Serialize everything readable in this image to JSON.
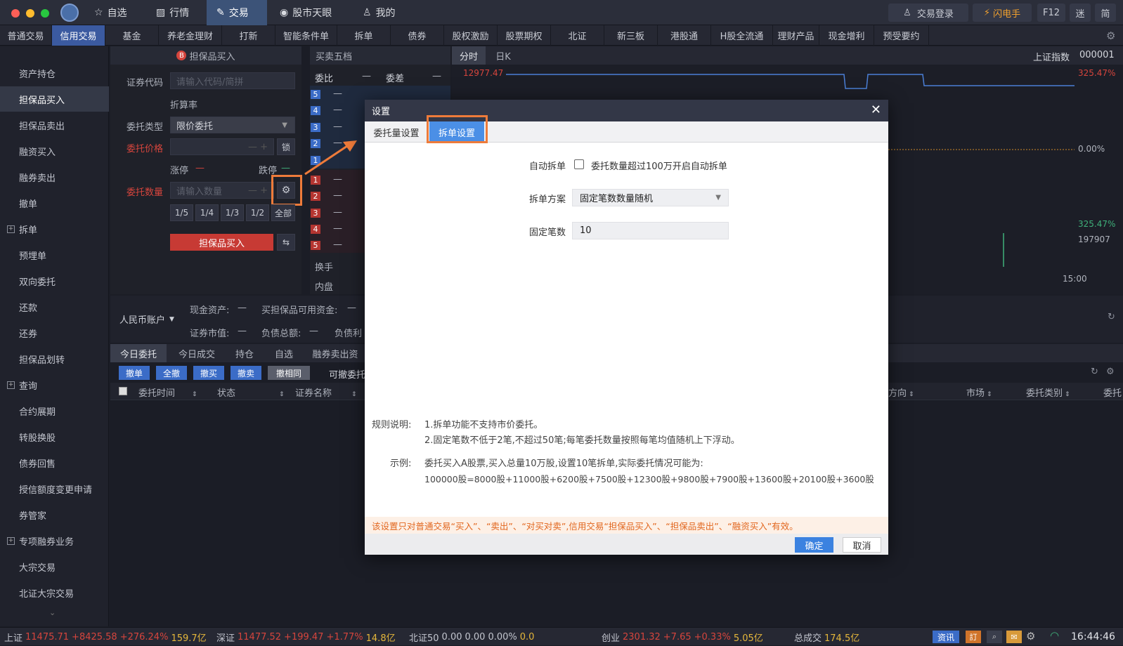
{
  "topnav": {
    "items": [
      {
        "label": "自选",
        "icon": "star-icon"
      },
      {
        "label": "行情",
        "icon": "chart-icon"
      },
      {
        "label": "交易",
        "icon": "hammer-icon"
      },
      {
        "label": "股市天眼",
        "icon": "eye-icon"
      },
      {
        "label": "我的",
        "icon": "user-icon"
      }
    ],
    "login": "交易登录",
    "flash": "闪电手",
    "f12": "F12",
    "mini": "迷",
    "simple": "简"
  },
  "subnav": {
    "tabs": [
      "普通交易",
      "信用交易",
      "基金",
      "养老金理财",
      "打新",
      "智能条件单",
      "拆单",
      "债券",
      "股权激励",
      "股票期权",
      "北证",
      "新三板",
      "港股通",
      "H股全流通",
      "理财产品",
      "现金增利",
      "预受要约"
    ]
  },
  "sidebar": {
    "items": [
      "资产持仓",
      "担保品买入",
      "担保品卖出",
      "融资买入",
      "融券卖出",
      "撤单",
      "拆单",
      "预埋单",
      "双向委托",
      "还款",
      "还券",
      "担保品划转",
      "查询",
      "合约展期",
      "转股换股",
      "债券回售",
      "授信额度变更申请",
      "券管家",
      "专项融券业务",
      "大宗交易",
      "北证大宗交易"
    ]
  },
  "order_form": {
    "header": "担保品买入",
    "header_badge": "B",
    "code_label": "证券代码",
    "code_placeholder": "请输入代码/简拼",
    "discount_label": "折算率",
    "type_label": "委托类型",
    "type_value": "限价委托",
    "price_label": "委托价格",
    "lock": "锁",
    "limit_up_label": "涨停",
    "limit_up_value": "—",
    "limit_down_label": "跌停",
    "limit_down_value": "—",
    "qty_label": "委托数量",
    "qty_placeholder": "请输入数量",
    "fractions": [
      "1/5",
      "1/4",
      "1/3",
      "1/2",
      "全部"
    ],
    "submit": "担保品买入"
  },
  "orderbook": {
    "header": "买卖五档",
    "wb_label": "委比",
    "wb_value": "—",
    "wc_label": "委差",
    "wc_value": "—",
    "sell": [
      "5",
      "4",
      "3",
      "2",
      "1"
    ],
    "buy": [
      "1",
      "2",
      "3",
      "4",
      "5"
    ],
    "dash": "—",
    "turnover_label": "换手",
    "inner_label": "内盘"
  },
  "chart": {
    "tab_intraday": "分时",
    "tab_daily": "日K",
    "index_name": "上证指数",
    "index_code": "000001",
    "price_top": "12977.47",
    "pct_top": "325.47%",
    "pct_mid": "0.00%",
    "pct_bot": "325.47%",
    "volume": "197907",
    "time_end": "15:00"
  },
  "account": {
    "currency": "人民币账户",
    "cash_label": "现金资产:",
    "cash_value": "—",
    "buy_avail_label": "买担保品可用资金:",
    "buy_avail_value": "—",
    "mv_label": "证券市值:",
    "mv_value": "—",
    "debt_label": "负债总额:",
    "debt_value": "—",
    "debt_interest_label": "负债利"
  },
  "orders": {
    "tabs": [
      "今日委托",
      "今日成交",
      "持仓",
      "自选",
      "融券卖出资"
    ],
    "actions": [
      "撤单",
      "全撤",
      "撤买",
      "撤卖",
      "撤相同"
    ],
    "cancellable": "可撤委托",
    "columns": [
      "委托时间",
      "状态",
      "证券名称"
    ],
    "right_columns": [
      "方向",
      "市场",
      "委托类别",
      "委托"
    ]
  },
  "dialog": {
    "title": "设置",
    "tabs": [
      "委托量设置",
      "拆单设置"
    ],
    "auto_split_label": "自动拆单",
    "auto_split_text": "委托数量超过100万开启自动拆单",
    "auto_split_checked": false,
    "scheme_label": "拆单方案",
    "scheme_value": "固定笔数数量随机",
    "fixed_label": "固定笔数",
    "fixed_value": "10",
    "rules_label": "规则说明:",
    "rule1": "1.拆单功能不支持市价委托。",
    "rule2": "2.固定笔数不低于2笔,不超过50笔;每笔委托数量按照每笔均值随机上下浮动。",
    "example_label": "示例:",
    "example1": "委托买入A股票,买入总量10万股,设置10笔拆单,实际委托情况可能为:",
    "example2": "100000股=8000股+11000股+6200股+7500股+12300股+9800股+7900股+13600股+20100股+3600股",
    "warning": "该设置只对普通交易“买入”、“卖出”、“对买对卖”,信用交易“担保品买入”、“担保品卖出”、“融资买入”有效。",
    "ok": "确定",
    "cancel": "取消"
  },
  "statusbar": {
    "sh_label": "上证",
    "sh_value": "11475.71",
    "sh_change": "+8425.58",
    "sh_pct": "+276.24%",
    "sh_amount": "159.7亿",
    "sz_label": "深证",
    "sz_value": "11477.52",
    "sz_change": "+199.47",
    "sz_pct": "+1.77%",
    "sz_amount": "14.8亿",
    "bz_label": "北证50",
    "bz_value": "0.00",
    "bz_change": "0.00",
    "bz_pct": "0.00%",
    "bz_amount": "0.0",
    "cy_label": "创业",
    "cy_value": "2301.32",
    "cy_change": "+7.65",
    "cy_pct": "+0.33%",
    "cy_amount": "5.05亿",
    "total_label": "总成交",
    "total_value": "174.5亿",
    "news": "资讯",
    "clock": "16:44:46"
  }
}
